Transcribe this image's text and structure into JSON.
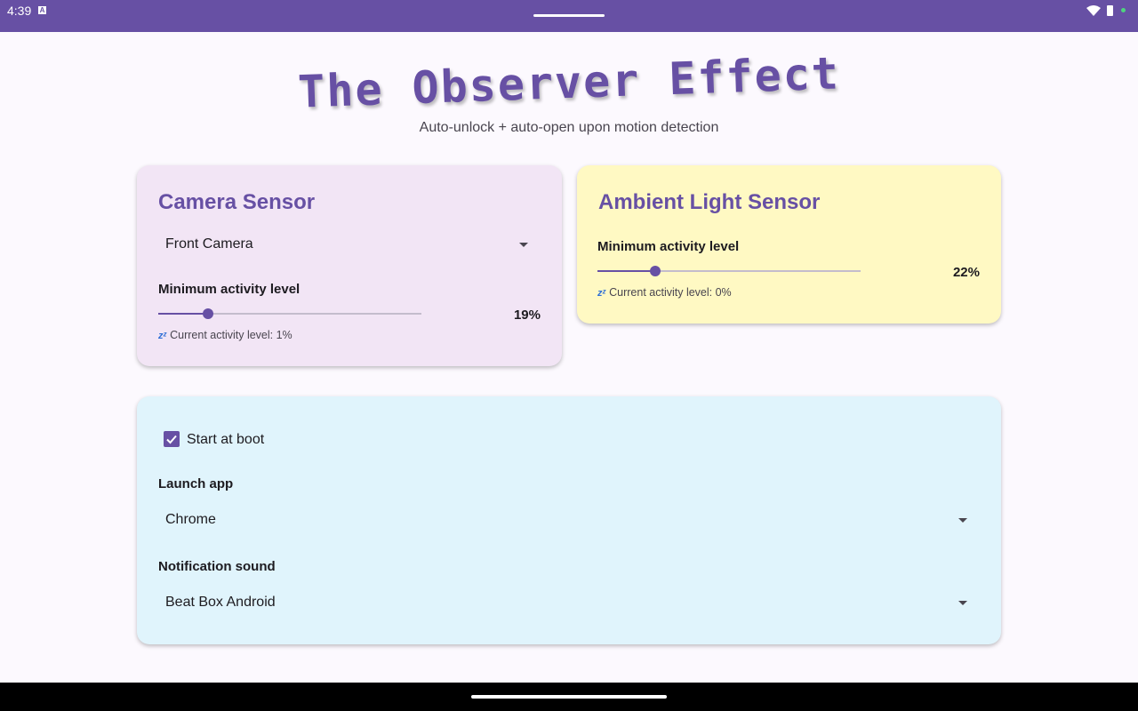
{
  "status_bar": {
    "time": "4:39",
    "notification_icon": "A",
    "icons": [
      "wifi-icon",
      "battery-icon",
      "dot-icon"
    ]
  },
  "header": {
    "title": "The Observer Effect",
    "subtitle": "Auto-unlock + auto-open upon motion detection"
  },
  "camera_card": {
    "title": "Camera Sensor",
    "camera_select": "Front Camera",
    "min_activity_label": "Minimum activity level",
    "min_activity_percent": 19,
    "min_activity_text": "19%",
    "current_activity_text": "Current activity level: 1%",
    "status_icon": "zzz-icon"
  },
  "light_card": {
    "title": "Ambient Light Sensor",
    "min_activity_label": "Minimum activity level",
    "min_activity_percent": 22,
    "min_activity_text": "22%",
    "current_activity_text": "Current activity level: 0%",
    "status_icon": "zzz-icon"
  },
  "settings_card": {
    "start_at_boot_label": "Start at boot",
    "start_at_boot_checked": true,
    "launch_app_label": "Launch app",
    "launch_app_value": "Chrome",
    "notification_sound_label": "Notification sound",
    "notification_sound_value": "Beat Box Android"
  },
  "colors": {
    "primary": "#6750a4",
    "camera_card_bg": "#f2e5f5",
    "light_card_bg": "#fff9c3",
    "settings_card_bg": "#e0f4fc"
  }
}
